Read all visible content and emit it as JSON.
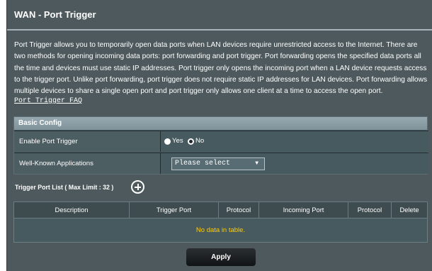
{
  "page": {
    "title": "WAN - Port Trigger",
    "description": "Port Trigger allows you to temporarily open data ports when LAN devices require unrestricted access to the Internet. There are two methods for opening incoming data ports: port forwarding and port trigger. Port forwarding opens the specified data ports all the time and devices must use static IP addresses. Port trigger only opens the incoming port when a LAN device requests access to the trigger port. Unlike port forwarding, port trigger does not require static IP addresses for LAN devices. Port forwarding allows multiple devices to share a single open port and port trigger only allows one client at a time to access the open port.",
    "faq_link": "Port Trigger FAQ"
  },
  "basic_config": {
    "header": "Basic Config",
    "enable_label": "Enable Port Trigger",
    "options": {
      "yes": "Yes",
      "no": "No"
    },
    "selected": "No",
    "apps_label": "Well-Known Applications",
    "apps_value": "Please select"
  },
  "trigger_list": {
    "title": "Trigger Port List ( Max Limit : 32 )",
    "columns": [
      "Description",
      "Trigger Port",
      "Protocol",
      "Incoming Port",
      "Protocol",
      "Delete"
    ],
    "empty_text": "No data in table."
  },
  "actions": {
    "apply": "Apply"
  },
  "colors": {
    "panel_bg": "#4d595d",
    "header_bar": "#8a9ca4",
    "empty_text": "#ffcc00",
    "button": "#1b1e20"
  }
}
